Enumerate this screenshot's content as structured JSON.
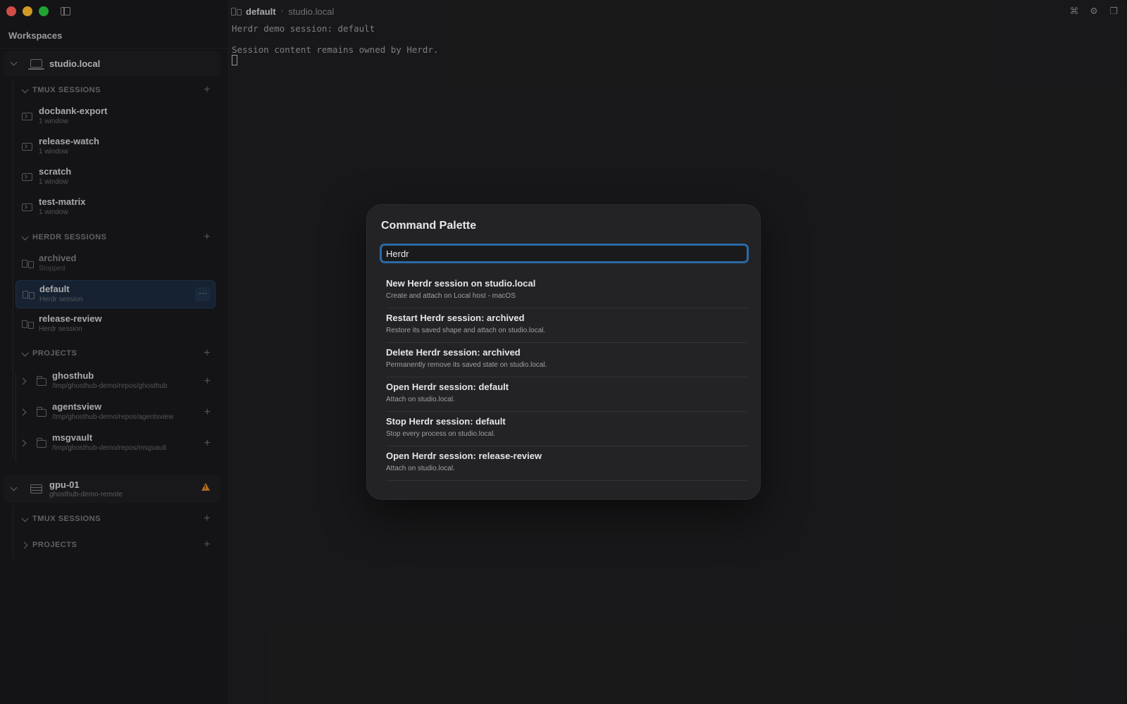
{
  "sidebar": {
    "title": "Workspaces",
    "hosts": [
      {
        "name": "studio.local",
        "sections": {
          "tmux": {
            "label": "TMUX SESSIONS",
            "items": [
              {
                "title": "docbank-export",
                "sub": "1 window"
              },
              {
                "title": "release-watch",
                "sub": "1 window"
              },
              {
                "title": "scratch",
                "sub": "1 window"
              },
              {
                "title": "test-matrix",
                "sub": "1 window"
              }
            ]
          },
          "herdr": {
            "label": "HERDR SESSIONS",
            "items": [
              {
                "title": "archived",
                "sub": "Stopped"
              },
              {
                "title": "default",
                "sub": "Herdr session",
                "more": "···"
              },
              {
                "title": "release-review",
                "sub": "Herdr session"
              }
            ]
          },
          "projects": {
            "label": "PROJECTS",
            "items": [
              {
                "title": "ghosthub",
                "sub": "/tmp/ghosthub-demo/repos/ghosthub"
              },
              {
                "title": "agentsview",
                "sub": "/tmp/ghosthub-demo/repos/agentsview"
              },
              {
                "title": "msgvault",
                "sub": "/tmp/ghosthub-demo/repos/msgvault"
              }
            ]
          }
        }
      },
      {
        "name": "gpu-01",
        "sub": "ghosthub-demo-remote",
        "sections": {
          "tmux": {
            "label": "TMUX SESSIONS"
          },
          "projects": {
            "label": "PROJECTS"
          }
        }
      }
    ]
  },
  "titlebar": {
    "session": "default",
    "separator": "›",
    "host": "studio.local",
    "icons": [
      "command-icon",
      "gear-icon",
      "window-icon"
    ]
  },
  "terminal": {
    "lines": [
      "Herdr demo session: default",
      "",
      "Session content remains owned by Herdr."
    ]
  },
  "palette": {
    "title": "Command Palette",
    "query": "Herdr",
    "results": [
      {
        "title": "New Herdr session on studio.local",
        "desc": "Create and attach on Local host - macOS"
      },
      {
        "title": "Restart Herdr session: archived",
        "desc": "Restore its saved shape and attach on studio.local."
      },
      {
        "title": "Delete Herdr session: archived",
        "desc": "Permanently remove its saved state on studio.local."
      },
      {
        "title": "Open Herdr session: default",
        "desc": "Attach on studio.local."
      },
      {
        "title": "Stop Herdr session: default",
        "desc": "Stop every process on studio.local."
      },
      {
        "title": "Open Herdr session: release-review",
        "desc": "Attach on studio.local."
      }
    ]
  },
  "colors": {
    "accent": "#2b6aa6",
    "selected_bg": "#1c2a3c",
    "warning": "#d9822b"
  }
}
